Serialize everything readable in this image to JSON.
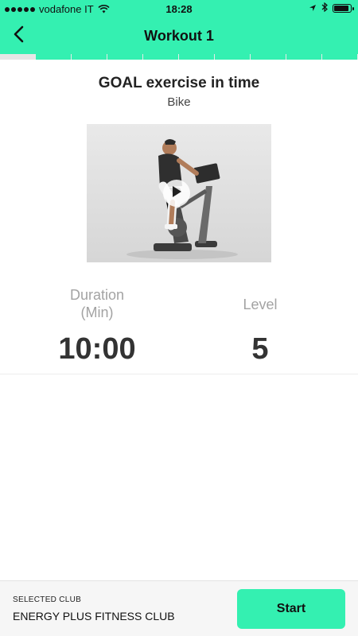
{
  "status_bar": {
    "carrier": "vodafone IT",
    "time": "18:28",
    "icons": [
      "signal-dots-icon",
      "wifi-icon",
      "location-arrow-icon",
      "bluetooth-icon",
      "battery-icon"
    ]
  },
  "nav": {
    "title": "Workout 1",
    "back_icon": "chevron-left-icon"
  },
  "progress_segments": {
    "total": 10,
    "current": 1
  },
  "exercise": {
    "title": "GOAL exercise in time",
    "subtitle": "Bike",
    "video_icon": "play-icon"
  },
  "stats": {
    "duration": {
      "label_line1": "Duration",
      "label_line2": "(Min)",
      "value": "10:00"
    },
    "level": {
      "label": "Level",
      "value": "5"
    }
  },
  "footer": {
    "caption": "SELECTED CLUB",
    "club_name": "ENERGY PLUS FITNESS CLUB",
    "start_label": "Start"
  },
  "colors": {
    "accent": "#34f0b1",
    "text_dark": "#222222",
    "label_gray": "#a3a3a3"
  }
}
